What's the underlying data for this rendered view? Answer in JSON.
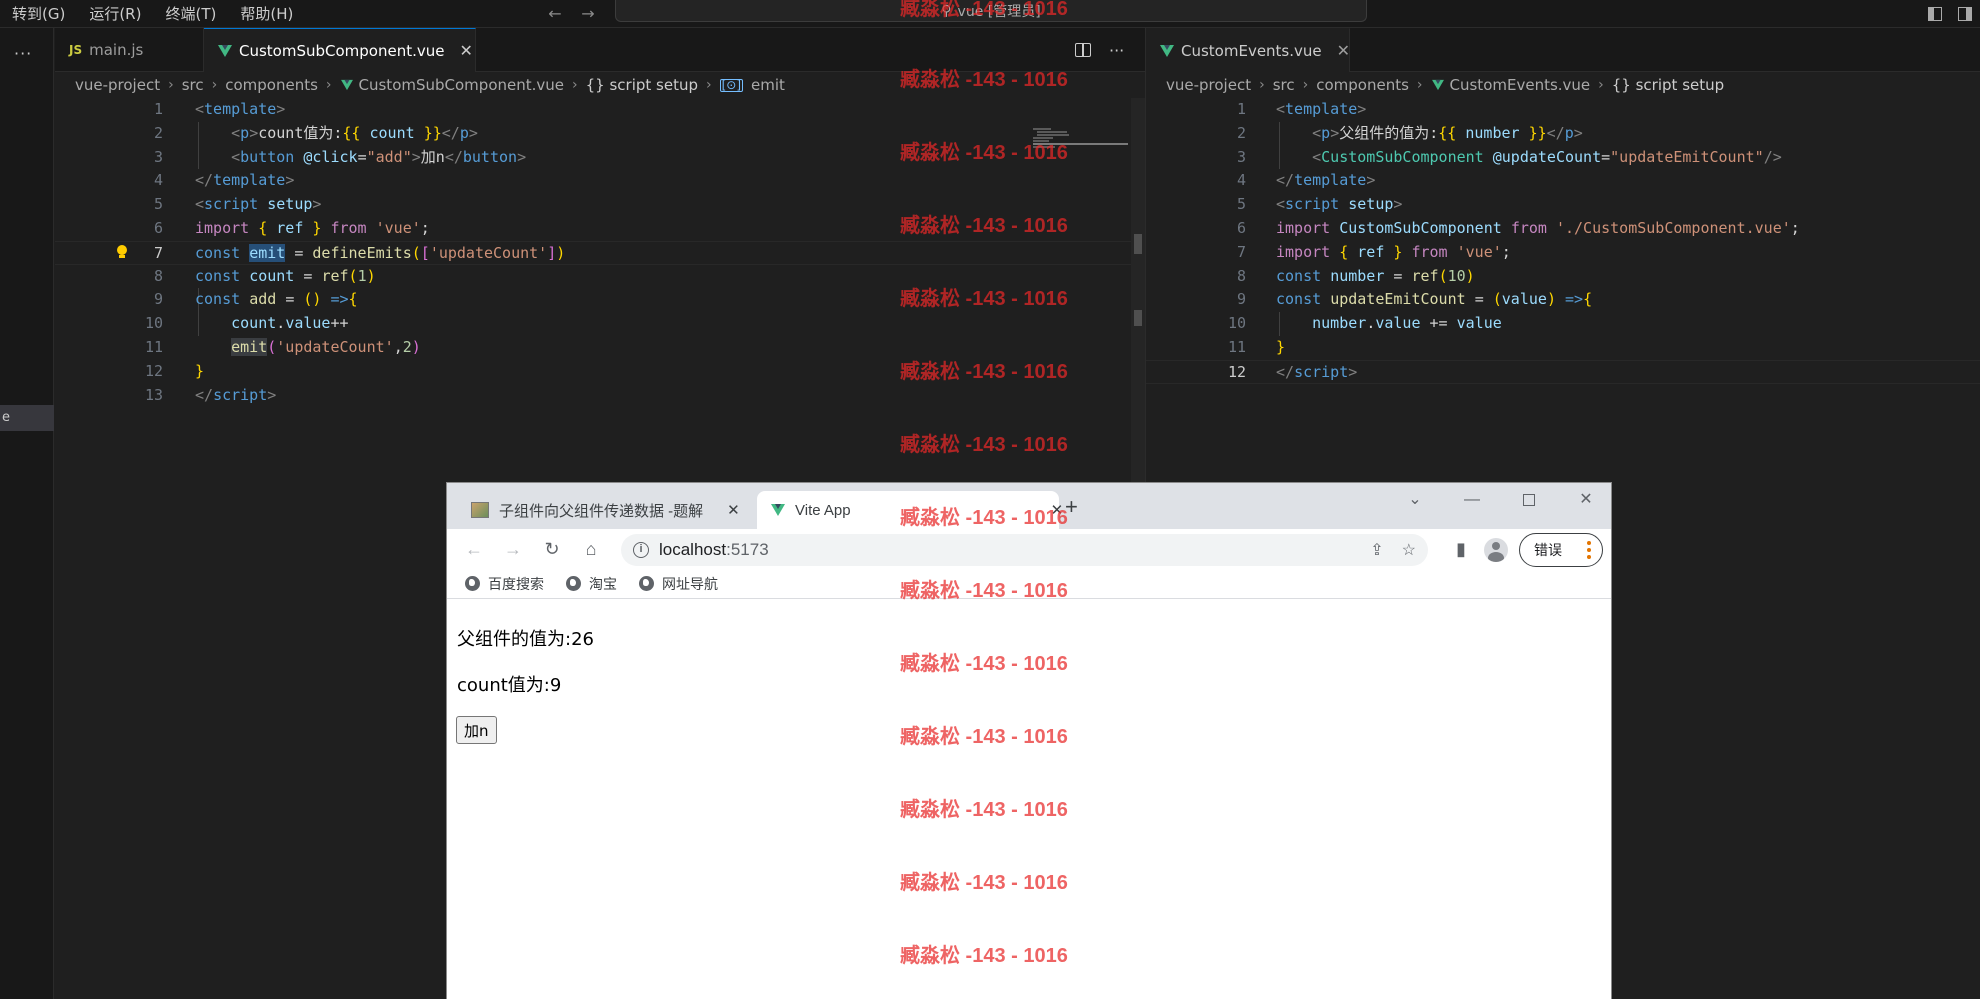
{
  "menubar": {
    "items": [
      "转到(G)",
      "运行(R)",
      "终端(T)",
      "帮助(H)"
    ],
    "search_text": "vue [管理员]"
  },
  "sidestrip": {
    "selected_label": "e"
  },
  "left_group": {
    "tabs": [
      {
        "label": "main.js",
        "icon": "js-file-icon"
      },
      {
        "label": "CustomSubComponent.vue",
        "icon": "vue-file-icon"
      }
    ],
    "breadcrumb": [
      "vue-project",
      "src",
      "components",
      "CustomSubComponent.vue",
      "{} script setup",
      "emit"
    ],
    "line_numbers": [
      "1",
      "2",
      "3",
      "4",
      "5",
      "6",
      "7",
      "8",
      "9",
      "10",
      "11",
      "12",
      "13"
    ],
    "current_line": "7"
  },
  "right_group": {
    "tabs": [
      {
        "label": "CustomEvents.vue",
        "icon": "vue-file-icon"
      }
    ],
    "breadcrumb": [
      "vue-project",
      "src",
      "components",
      "CustomEvents.vue",
      "{} script setup"
    ],
    "line_numbers": [
      "1",
      "2",
      "3",
      "4",
      "5",
      "6",
      "7",
      "8",
      "9",
      "10",
      "11",
      "12"
    ],
    "current_line": "12"
  },
  "browser": {
    "tabs": [
      {
        "label": "子组件向父组件传递数据 -题解"
      },
      {
        "label": "Vite App"
      }
    ],
    "url_host": "localhost",
    "url_port": ":5173",
    "error_button": "错误",
    "bookmarks": [
      "百度搜索",
      "淘宝",
      "网址导航"
    ],
    "content": {
      "parent_value": "父组件的值为:26",
      "count_value": "count值为:9",
      "button_label": "加n"
    }
  },
  "watermark": "臧淼松 -143 - 1016",
  "colors": {
    "editor_bg": "#1f1f1f",
    "accent": "#0078d4",
    "vue_green": "#41b883",
    "watermark": "#e82828"
  }
}
